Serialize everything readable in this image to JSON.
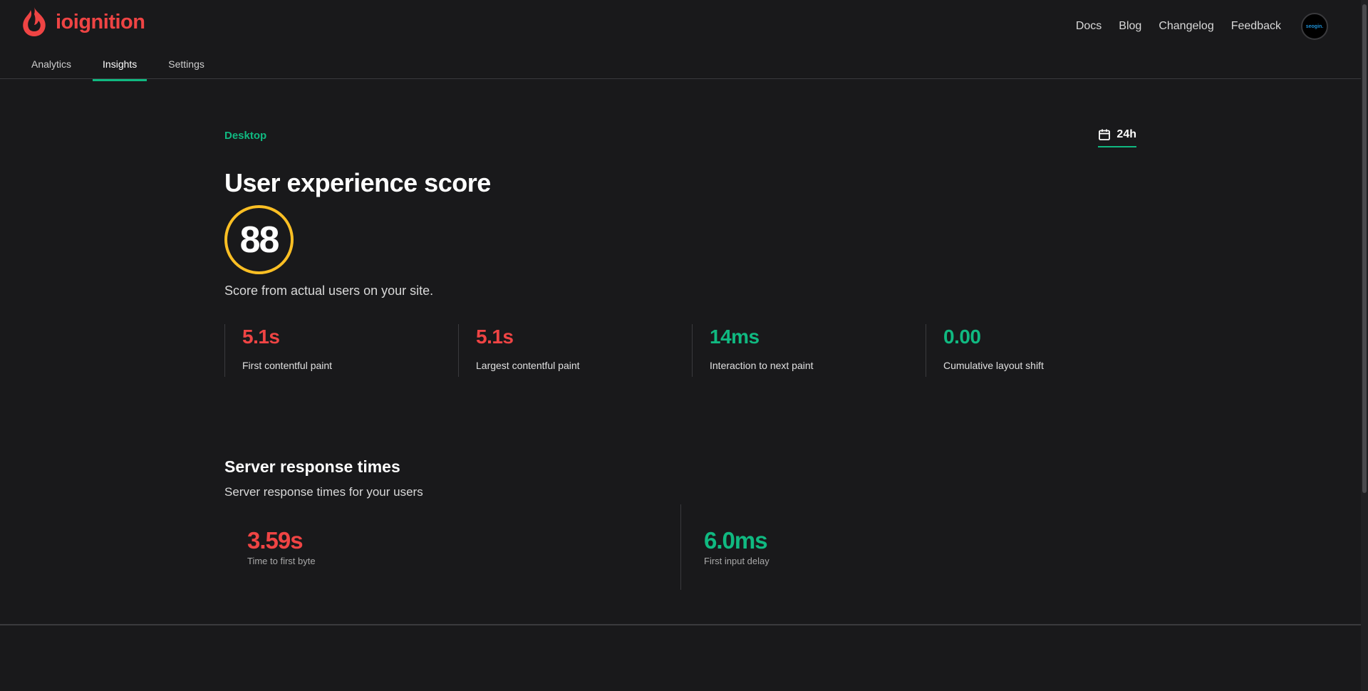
{
  "brand": {
    "name": "ioignition",
    "logo_icon": "flame-icon",
    "color": "#ef4444"
  },
  "topnav": {
    "links": [
      "Docs",
      "Blog",
      "Changelog",
      "Feedback"
    ],
    "avatar_text": "seogin."
  },
  "tabs": [
    {
      "label": "Analytics",
      "active": false
    },
    {
      "label": "Insights",
      "active": true
    },
    {
      "label": "Settings",
      "active": false
    }
  ],
  "filters": {
    "platform": "Desktop",
    "range_icon": "calendar-icon",
    "range": "24h"
  },
  "ux": {
    "title": "User experience score",
    "score": "88",
    "subtitle": "Score from actual users on your site.",
    "metrics": [
      {
        "value": "5.1s",
        "label": "First contentful paint",
        "status": "poor"
      },
      {
        "value": "5.1s",
        "label": "Largest contentful paint",
        "status": "poor"
      },
      {
        "value": "14ms",
        "label": "Interaction to next paint",
        "status": "good"
      },
      {
        "value": "0.00",
        "label": "Cumulative layout shift",
        "status": "good"
      }
    ]
  },
  "server": {
    "title": "Server response times",
    "subtitle": "Server response times for your users",
    "metrics": [
      {
        "value": "3.59s",
        "label": "Time to first byte",
        "status": "poor"
      },
      {
        "value": "6.0ms",
        "label": "First input delay",
        "status": "good"
      }
    ]
  },
  "colors": {
    "good": "#10b981",
    "poor": "#ef4444",
    "score_ring": "#fbbf24",
    "background": "#19191b"
  }
}
